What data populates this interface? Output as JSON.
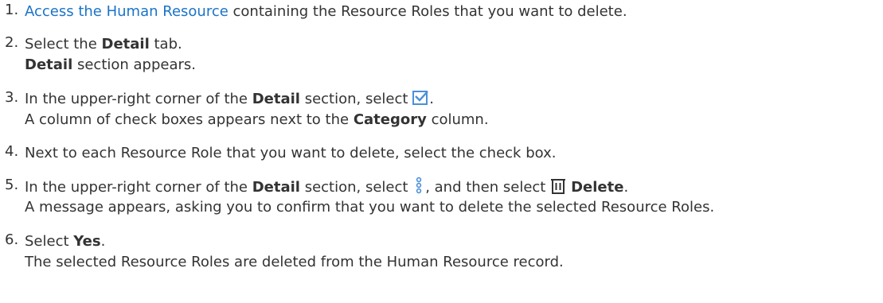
{
  "steps": [
    {
      "number": "1.",
      "link": "Access the Human Resource",
      "text_after_link": " containing the Resource Roles that you want to delete."
    },
    {
      "number": "2.",
      "text_before": "Select the ",
      "bold": "Detail",
      "text_after": " tab.",
      "result_bold": "Detail",
      "result_text": " section appears."
    },
    {
      "number": "3.",
      "text_before": "In the upper-right corner of the ",
      "bold": "Detail",
      "text_after": " section, select ",
      "icon": "checkbox-select-icon",
      "text_end": ".",
      "result_before": "A column of check boxes appears next to the ",
      "result_bold": "Category",
      "result_after": " column."
    },
    {
      "number": "4.",
      "text": "Next to each Resource Role that you want to delete, select the check box."
    },
    {
      "number": "5.",
      "text_before": "In the upper-right corner of the ",
      "bold": "Detail",
      "text_after": " section, select ",
      "icon1": "vertical-ellipsis-icon",
      "text_mid": ", and then select ",
      "icon2": "trash-icon",
      "bold2": "Delete",
      "text_end": ".",
      "result_text": "A message appears, asking you to confirm that you want to delete the selected Resource Roles."
    },
    {
      "number": "6.",
      "text_before": "Select ",
      "bold": "Yes",
      "text_end": ".",
      "result_text": "The selected Resource Roles are deleted from the Human Resource record."
    }
  ],
  "colors": {
    "link": "#1a73c8",
    "text": "#333333",
    "icon_blue": "#4a90d9"
  }
}
